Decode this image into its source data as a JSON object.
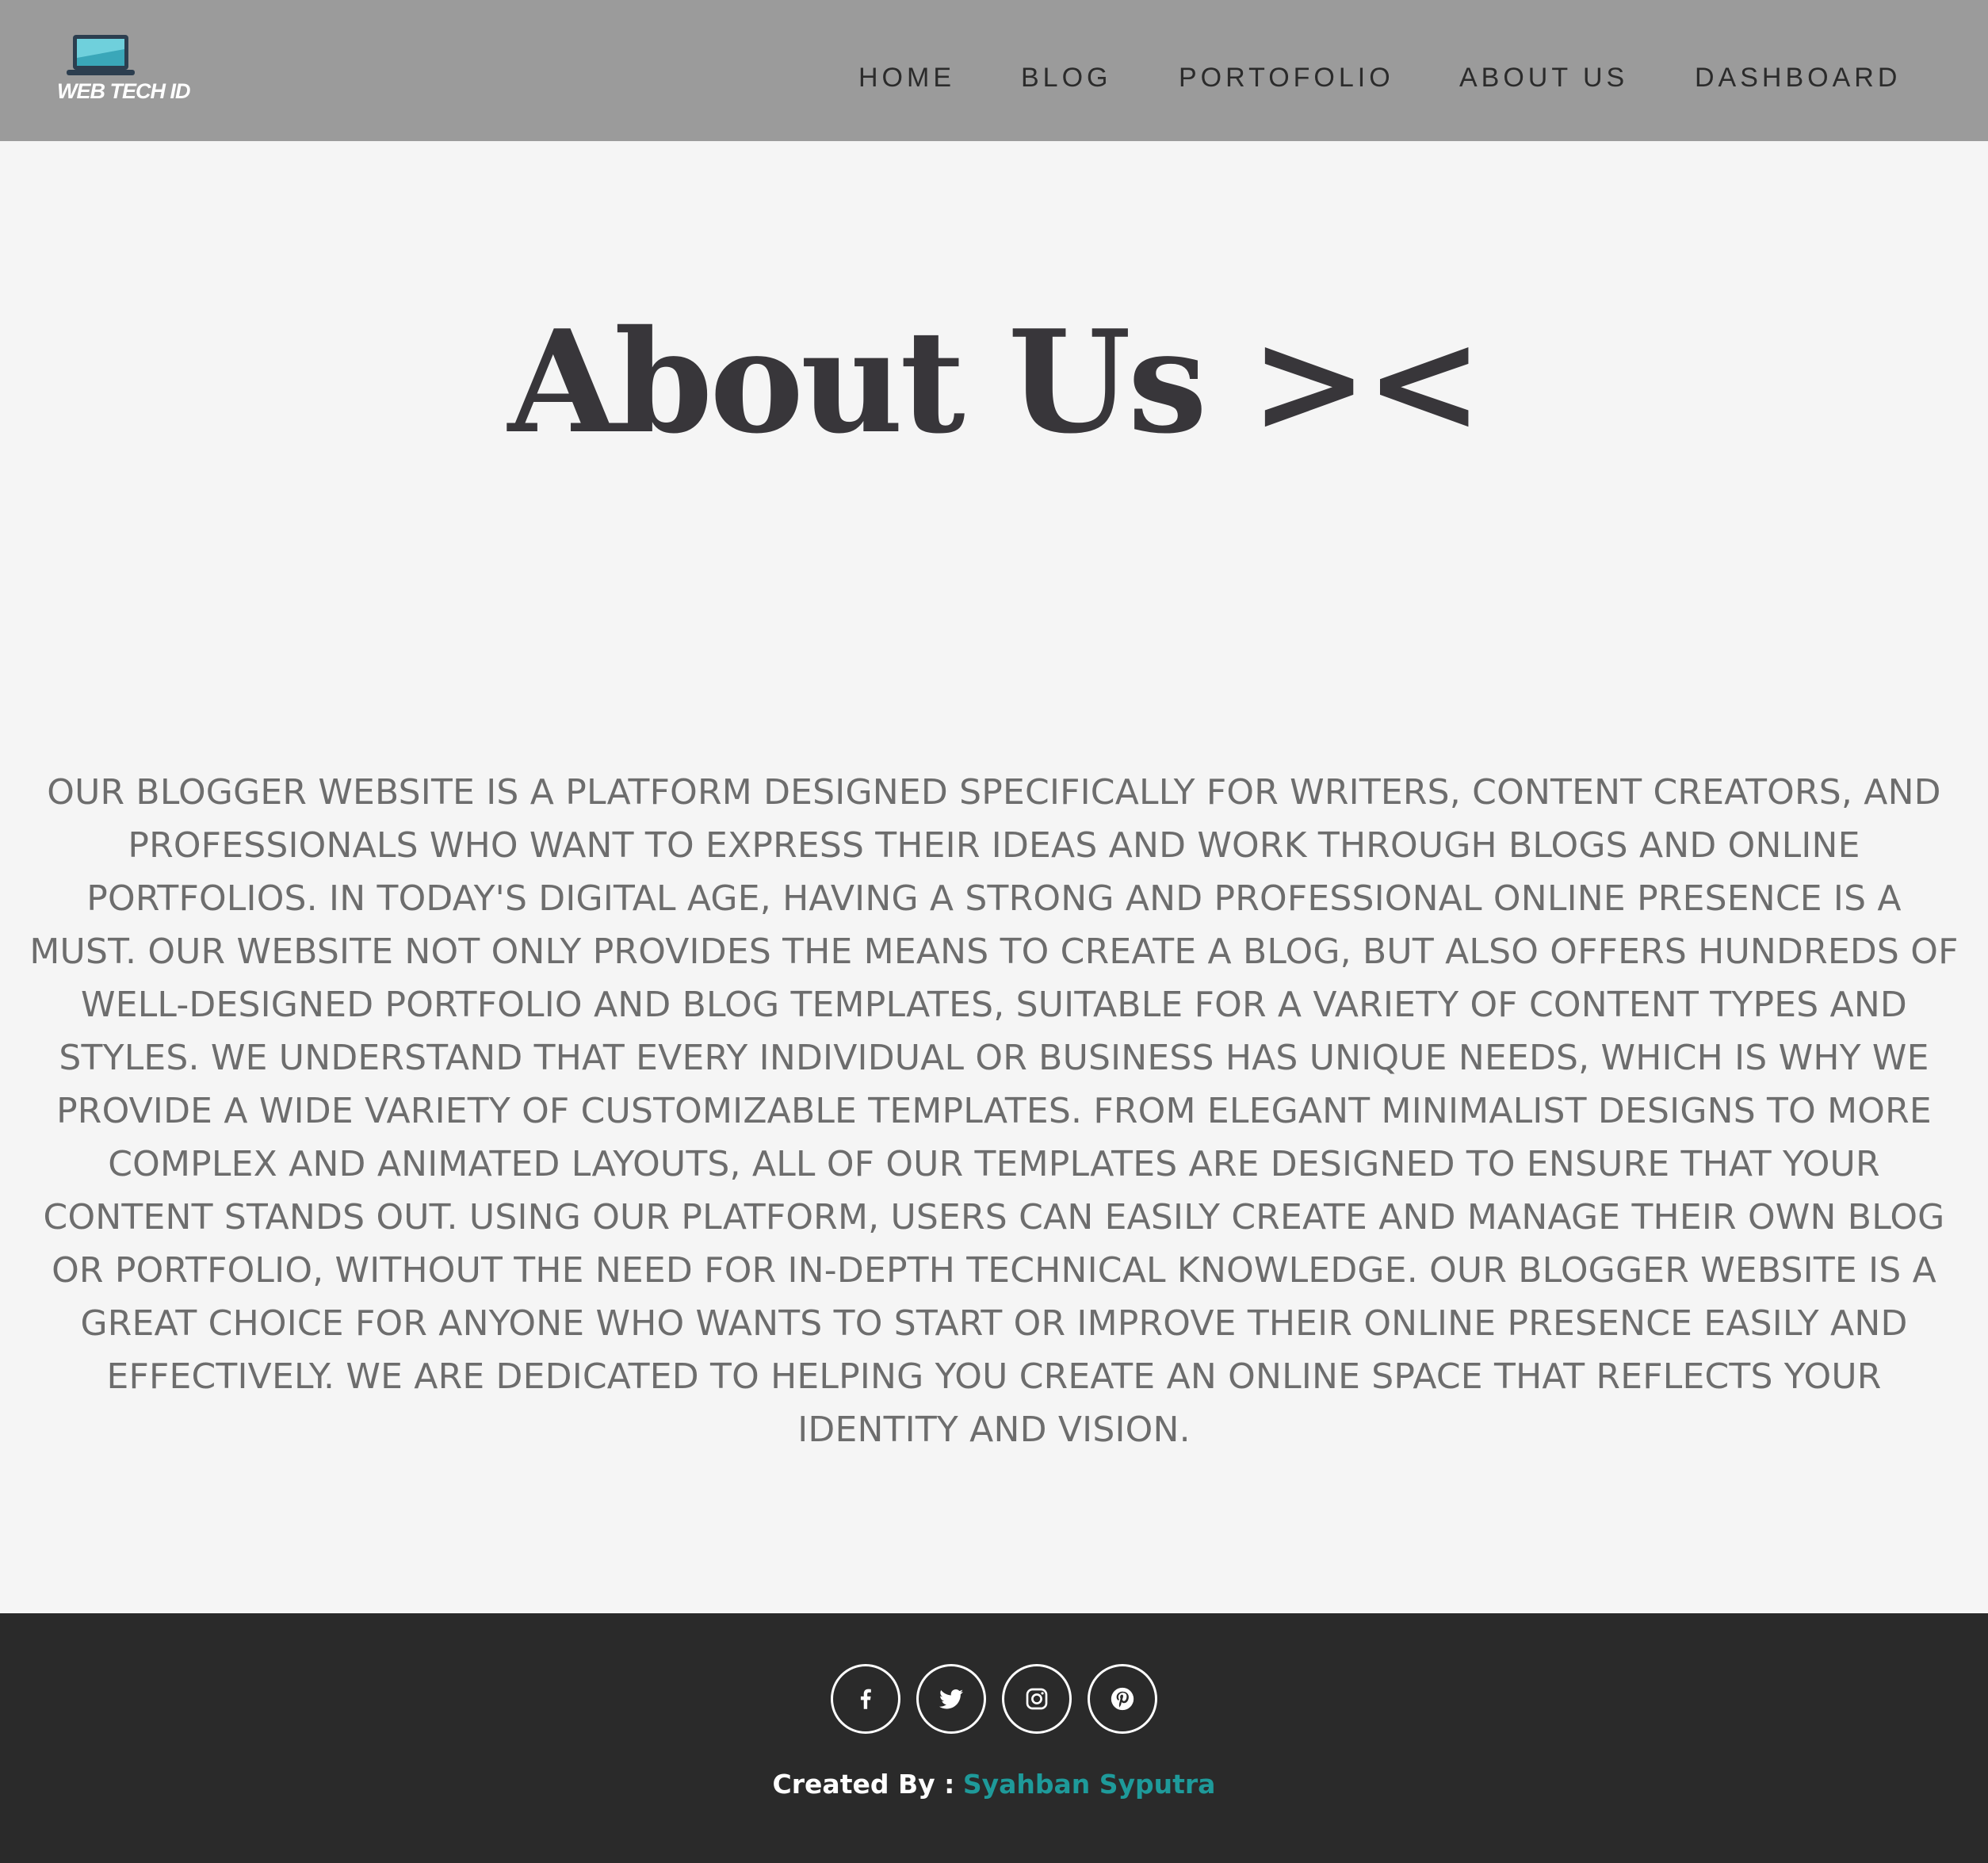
{
  "header": {
    "logo_text": "WEB TECH ID",
    "nav": [
      {
        "label": "HOME"
      },
      {
        "label": "BLOG"
      },
      {
        "label": "PORTOFOLIO"
      },
      {
        "label": "ABOUT US"
      },
      {
        "label": "DASHBOARD"
      }
    ]
  },
  "hero": {
    "title": "About Us ><"
  },
  "about": {
    "paragraph": "Our blogger website is a platform designed specifically for writers, content creators, and professionals who want to express their ideas and work through blogs and online portfolios. In today's digital age, having a strong and professional online presence is a must. Our website not only provides the means to create a blog, but also offers hundreds of well-designed portfolio and blog templates, suitable for a variety of content types and styles. We understand that every individual or business has unique needs, which is why we provide a wide variety of customizable templates. From elegant minimalist designs to more complex and animated layouts, all of our templates are designed to ensure that your content stands out. Using our platform, users can easily create and manage their own blog or portfolio, without the need for in-depth technical knowledge. Our blogger website is a great choice for anyone who wants to start or improve their online presence easily and effectively. We are dedicated to helping you create an online space that reflects your identity and vision."
  },
  "footer": {
    "social": [
      {
        "icon": "facebook-icon"
      },
      {
        "icon": "twitter-icon"
      },
      {
        "icon": "instagram-icon"
      },
      {
        "icon": "pinterest-icon"
      }
    ],
    "credit_label": "Created By :",
    "credit_author": "Syahban Syputra"
  },
  "colors": {
    "header_bg": "#9b9b9b",
    "page_bg": "#f5f5f5",
    "footer_bg": "#2a2a2a",
    "accent": "#1e9a9a",
    "title": "#38363a",
    "body_text": "#6d6d6d"
  }
}
